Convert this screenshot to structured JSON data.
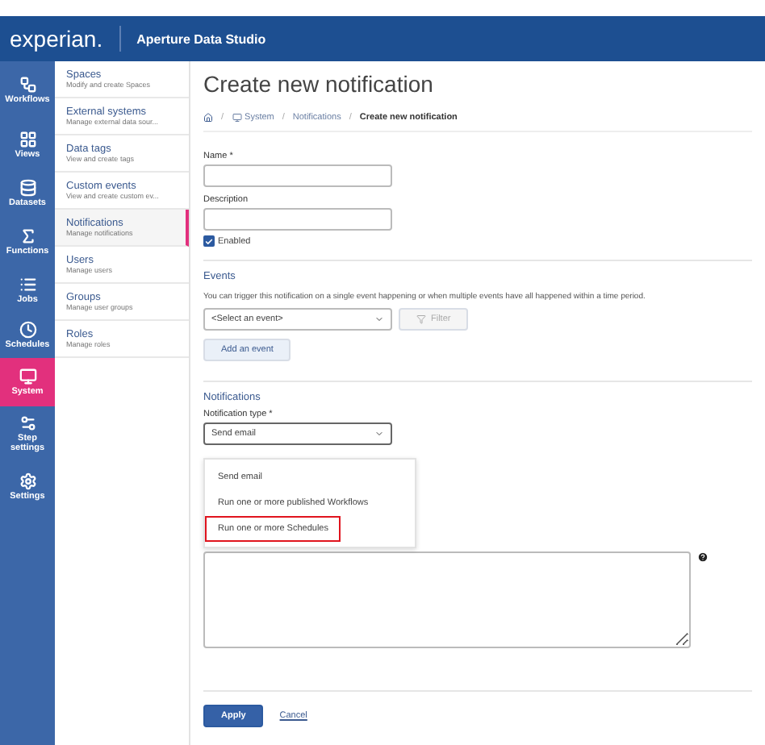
{
  "header": {
    "logo": "experian.",
    "app_title": "Aperture Data Studio"
  },
  "rail": [
    {
      "kind": "workflows",
      "label": "Workflows",
      "selected": false
    },
    {
      "kind": "views",
      "label": "Views",
      "selected": false
    },
    {
      "kind": "datasets",
      "label": "Datasets",
      "selected": false
    },
    {
      "kind": "functions",
      "label": "Functions",
      "selected": false
    },
    {
      "kind": "jobs",
      "label": "Jobs",
      "selected": false
    },
    {
      "kind": "schedules",
      "label": "Schedules",
      "selected": false
    },
    {
      "kind": "system",
      "label": "System",
      "selected": true
    },
    {
      "kind": "step",
      "label": "Step settings",
      "selected": false
    },
    {
      "kind": "settings",
      "label": "Settings",
      "selected": false
    }
  ],
  "sidebar": {
    "items": [
      {
        "title": "Spaces",
        "subtitle": "Modify and create Spaces",
        "selected": false
      },
      {
        "title": "External systems",
        "subtitle": "Manage external data sour...",
        "selected": false
      },
      {
        "title": "Data tags",
        "subtitle": "View and create tags",
        "selected": false
      },
      {
        "title": "Custom events",
        "subtitle": "View and create custom ev...",
        "selected": false
      },
      {
        "title": "Notifications",
        "subtitle": "Manage notifications",
        "selected": true
      },
      {
        "title": "Users",
        "subtitle": "Manage users",
        "selected": false
      },
      {
        "title": "Groups",
        "subtitle": "Manage user groups",
        "selected": false
      },
      {
        "title": "Roles",
        "subtitle": "Manage roles",
        "selected": false
      }
    ]
  },
  "page": {
    "title": "Create new notification",
    "breadcrumb_separator": "/",
    "breadcrumb": [
      {
        "kind": "home"
      },
      {
        "kind": "system",
        "label": "System"
      },
      {
        "kind": "link",
        "label": "Notifications"
      },
      {
        "kind": "current",
        "label": "Create new notification"
      }
    ],
    "name": {
      "label": "Name *"
    },
    "description": {
      "label": "Description"
    },
    "enabled": {
      "label": "Enabled",
      "checked": true
    },
    "events": {
      "heading": "Events",
      "text": "You can trigger this notification on a single event happening or when multiple events have all happened within a time period.",
      "select": "<Select an event>",
      "filter_button": "Filter",
      "filter_disabled": true,
      "add_button": "Add an event"
    },
    "notifications": {
      "heading": "Notifications",
      "type_label": "Notification type *",
      "type_value": "Send email",
      "options": [
        {
          "label": "Send email",
          "highlighted": false
        },
        {
          "label": "Run one or more published Workflows",
          "highlighted": false
        },
        {
          "label": "Run one or more Schedules",
          "highlighted": true
        }
      ]
    },
    "apply": "Apply",
    "cancel": "Cancel"
  }
}
